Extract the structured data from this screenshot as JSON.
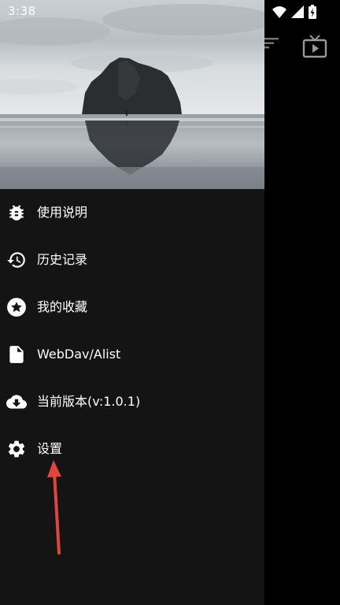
{
  "status_bar": {
    "time": "3:38",
    "icons": [
      "wifi-icon",
      "cell-signal-icon",
      "battery-charging-icon"
    ]
  },
  "background_app": {
    "icons": [
      "filter-icon",
      "tv-play-icon"
    ]
  },
  "drawer": {
    "header_image": "landscape-photo",
    "items": [
      {
        "label": "使用说明",
        "icon": "bug-icon"
      },
      {
        "label": "历史记录",
        "icon": "history-icon"
      },
      {
        "label": "我的收藏",
        "icon": "star-icon"
      },
      {
        "label": "WebDav/Alist",
        "icon": "file-icon"
      },
      {
        "label": "当前版本(v:1.0.1)",
        "icon": "cloud-download-icon"
      },
      {
        "label": "设置",
        "icon": "gear-icon"
      }
    ]
  },
  "annotation": {
    "type": "arrow",
    "color": "#e0463a",
    "target": "设置"
  },
  "colors": {
    "drawer_bg": "#141414",
    "text": "#ffffff",
    "accent_arrow": "#e0463a"
  }
}
